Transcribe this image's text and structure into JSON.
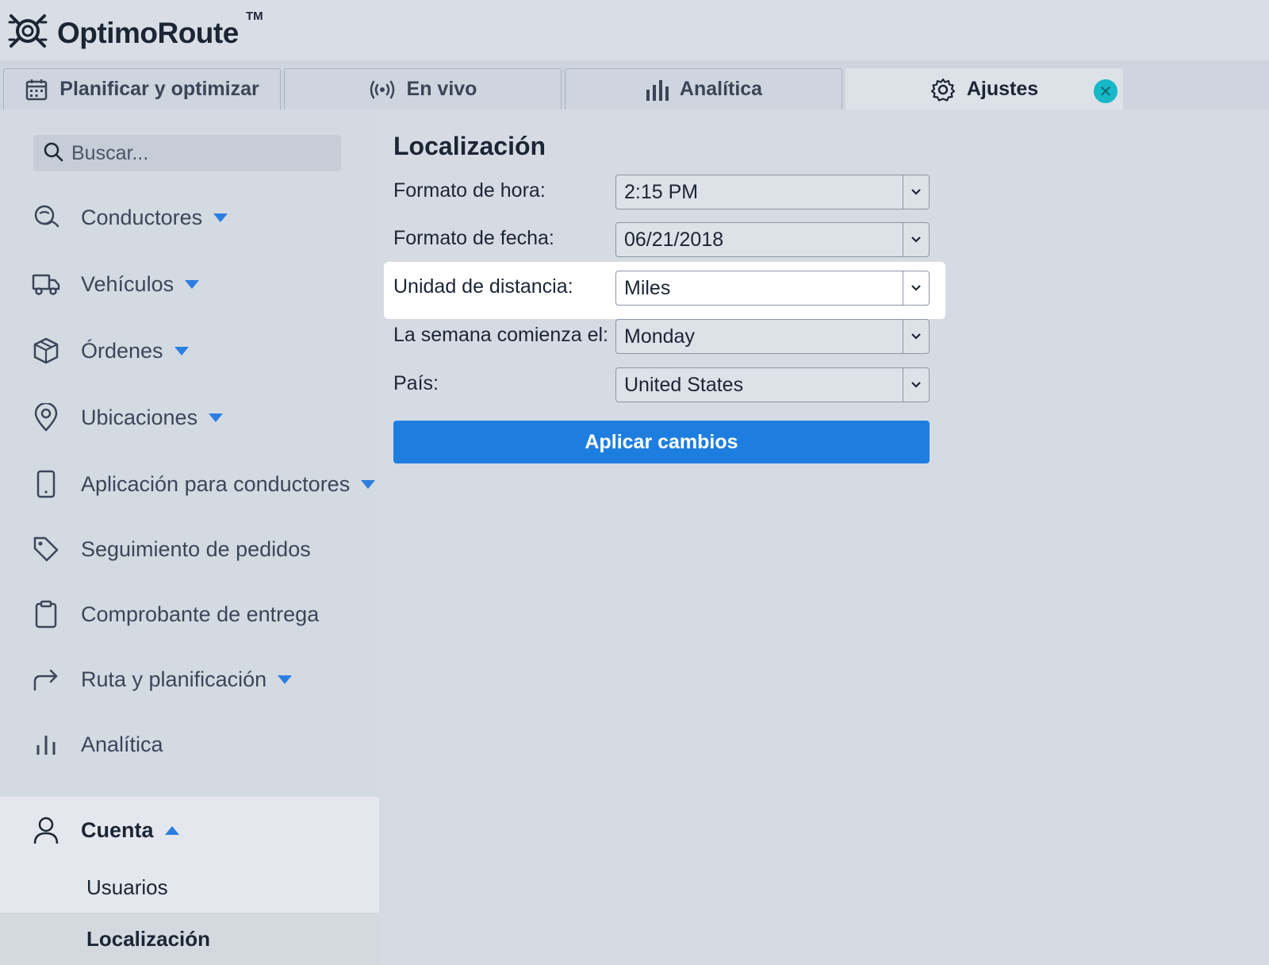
{
  "app": {
    "name": "OptimoRoute",
    "trademark": "TM"
  },
  "tabs": [
    {
      "label": "Planificar y optimizar",
      "icon": "calendar-icon"
    },
    {
      "label": "En vivo",
      "icon": "broadcast-icon"
    },
    {
      "label": "Analítica",
      "icon": "bar-chart-icon"
    },
    {
      "label": "Ajustes",
      "icon": "gear-icon",
      "active": true
    }
  ],
  "sidebar": {
    "search_placeholder": "Buscar...",
    "items": [
      {
        "label": "Conductores",
        "icon": "driver-icon",
        "expandable": true
      },
      {
        "label": "Vehículos",
        "icon": "truck-icon",
        "expandable": true
      },
      {
        "label": "Órdenes",
        "icon": "package-icon",
        "expandable": true
      },
      {
        "label": "Ubicaciones",
        "icon": "map-pin-icon",
        "expandable": true
      },
      {
        "label": "Aplicación para conductores",
        "icon": "phone-icon",
        "expandable": true
      },
      {
        "label": "Seguimiento de pedidos",
        "icon": "tag-icon",
        "expandable": false
      },
      {
        "label": "Comprobante de entrega",
        "icon": "clipboard-icon",
        "expandable": false
      },
      {
        "label": "Ruta y planificación",
        "icon": "route-arrow-icon",
        "expandable": true
      },
      {
        "label": "Analítica",
        "icon": "bar-chart-icon",
        "expandable": false
      }
    ],
    "account": {
      "label": "Cuenta",
      "icon": "user-icon",
      "expanded": true,
      "subitems": [
        {
          "label": "Usuarios"
        },
        {
          "label": "Localización",
          "active": true
        }
      ]
    }
  },
  "main": {
    "title": "Localización",
    "fields": [
      {
        "label": "Formato de hora:",
        "value": "2:15 PM"
      },
      {
        "label": "Formato de fecha:",
        "value": "06/21/2018"
      },
      {
        "label": "Unidad de distancia:",
        "value": "Miles",
        "highlighted": true
      },
      {
        "label": "La semana comienza el:",
        "value": "Monday"
      },
      {
        "label": "País:",
        "value": "United States"
      }
    ],
    "apply_label": "Aplicar cambios"
  },
  "colors": {
    "accent": "#1e7ee0",
    "close": "#17b8c8",
    "background": "#d6dbe3"
  }
}
